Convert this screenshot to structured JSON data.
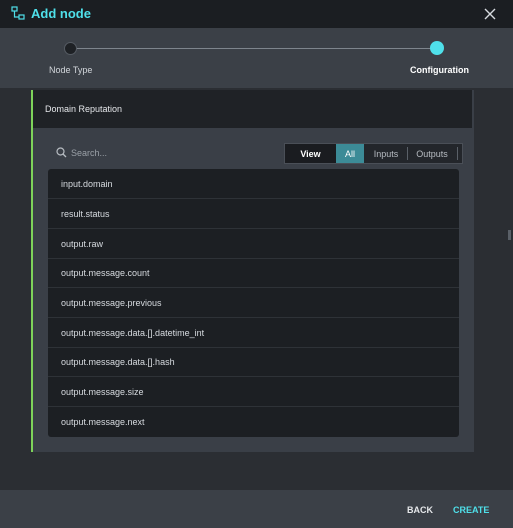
{
  "header": {
    "title": "Add node",
    "logo_icon": "nodes-icon",
    "close_icon": "close-icon"
  },
  "stepper": {
    "steps": [
      {
        "label": "Node Type",
        "state": "done"
      },
      {
        "label": "Configuration",
        "state": "current"
      }
    ],
    "accent": "#4fe0ea"
  },
  "panel": {
    "title": "Domain Reputation",
    "accent_border": "#7ed35a",
    "search": {
      "placeholder": "Search..."
    },
    "filter": {
      "view_label": "View",
      "options": [
        "All",
        "Inputs",
        "Outputs"
      ],
      "selected": "All"
    },
    "items": [
      "input.domain",
      "result.status",
      "output.raw",
      "output.message.count",
      "output.message.previous",
      "output.message.data.[].datetime_int",
      "output.message.data.[].hash",
      "output.message.size",
      "output.message.next"
    ]
  },
  "footer": {
    "back_label": "BACK",
    "create_label": "CREATE"
  }
}
